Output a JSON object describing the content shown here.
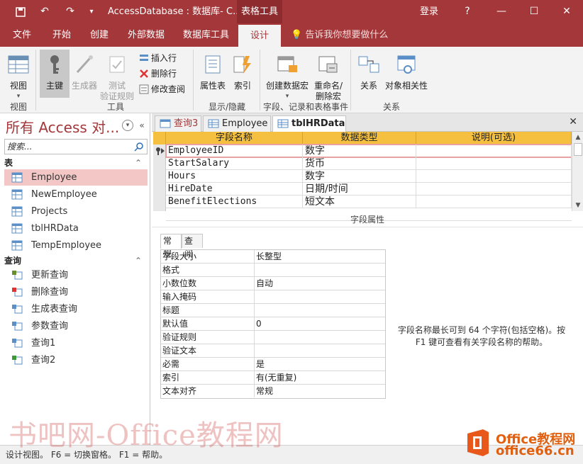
{
  "titlebar": {
    "title": "AccessDatabase : 数据库- C...",
    "context_tab": "表格工具",
    "login": "登录",
    "help": "?",
    "minimize": "—",
    "maximize": "☐",
    "close": "✕"
  },
  "tabs": {
    "file": "文件",
    "home": "开始",
    "create": "创建",
    "external": "外部数据",
    "dbtools": "数据库工具",
    "design": "设计",
    "tell_me": "告诉我你想要做什么"
  },
  "ribbon": {
    "view_label": "视图",
    "primary_key": "主键",
    "builder": "生成器",
    "test_rules_1": "测试",
    "test_rules_2": "验证规则",
    "insert_rows": "插入行",
    "delete_rows": "删除行",
    "modify_lookups": "修改查阅",
    "property_sheet": "属性表",
    "indexes": "索引",
    "create_macros_1": "创建数据宏",
    "rename_macro_1": "重命名/",
    "rename_macro_2": "删除宏",
    "relationships": "关系",
    "object_deps": "对象相关性",
    "groups": {
      "view": "视图",
      "tools": "工具",
      "show_hide": "显示/隐藏",
      "field_events": "字段、记录和表格事件",
      "relationships": "关系"
    }
  },
  "nav": {
    "title": "所有 Access 对...",
    "search_placeholder": "搜索...",
    "section_tables": "表",
    "tables": [
      "Employee",
      "NewEmployee",
      "Projects",
      "tblHRData",
      "TempEmployee"
    ],
    "section_queries": "查询",
    "queries": [
      "更新查询",
      "删除查询",
      "生成表查询",
      "参数查询",
      "查询1",
      "查询2"
    ]
  },
  "doc_tabs": [
    "查询3",
    "Employee",
    "tblHRData"
  ],
  "grid": {
    "headers": [
      "字段名称",
      "数据类型",
      "说明(可选)"
    ],
    "rows": [
      {
        "name": "EmployeeID",
        "type": "数字",
        "desc": ""
      },
      {
        "name": "StartSalary",
        "type": "货币",
        "desc": ""
      },
      {
        "name": "Hours",
        "type": "数字",
        "desc": ""
      },
      {
        "name": "HireDate",
        "type": "日期/时间",
        "desc": ""
      },
      {
        "name": "BenefitElections",
        "type": "短文本",
        "desc": ""
      }
    ]
  },
  "field_props": {
    "label": "字段属性",
    "tab_general": "常规",
    "tab_lookup": "查阅",
    "rows": [
      {
        "k": "字段大小",
        "v": "长整型"
      },
      {
        "k": "格式",
        "v": ""
      },
      {
        "k": "小数位数",
        "v": "自动"
      },
      {
        "k": "输入掩码",
        "v": ""
      },
      {
        "k": "标题",
        "v": ""
      },
      {
        "k": "默认值",
        "v": "0"
      },
      {
        "k": "验证规则",
        "v": ""
      },
      {
        "k": "验证文本",
        "v": ""
      },
      {
        "k": "必需",
        "v": "是"
      },
      {
        "k": "索引",
        "v": "有(无重复)"
      },
      {
        "k": "文本对齐",
        "v": "常规"
      }
    ],
    "help": "字段名称最长可到 64 个字符(包括空格)。按 F1 键可查看有关字段名称的帮助。"
  },
  "status": "设计视图。  F6 = 切换窗格。  F1 = 帮助。",
  "watermark": "书吧网-Office教程网",
  "logo": {
    "brand": "Office教程网",
    "domain": "office66.cn"
  },
  "colors": {
    "accent": "#a4373a",
    "header_yellow": "#f5c040",
    "selected_nav": "#f4c7c7"
  }
}
